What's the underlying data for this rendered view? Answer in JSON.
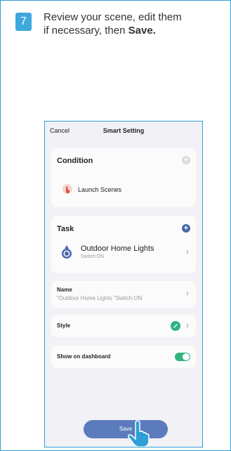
{
  "step": {
    "number": "7"
  },
  "instruction": {
    "line1": "Review your scene, edit them",
    "line2": "if necessary, then ",
    "emphasis": "Save."
  },
  "phone": {
    "header": {
      "cancel": "Cancel",
      "title": "Smart Setting"
    },
    "condition": {
      "title": "Condition",
      "item": "Launch Scenes"
    },
    "task": {
      "title": "Task",
      "device": "Outdoor Home Lights",
      "status": "Switch:ON"
    },
    "name": {
      "label": "Name",
      "value": "“Outdoor Home Lights ”Swtich:ON"
    },
    "style": {
      "label": "Style"
    },
    "dashboard": {
      "label": "Show on dashboard",
      "enabled": true
    },
    "save_label": "Save"
  },
  "colors": {
    "frame": "#2f9fd6",
    "badge": "#3fa8dc",
    "save_button": "#5b7bbd",
    "toggle": "#2fb47f",
    "task_plus": "#4a66a8",
    "style_icon": "#2fb47f"
  }
}
